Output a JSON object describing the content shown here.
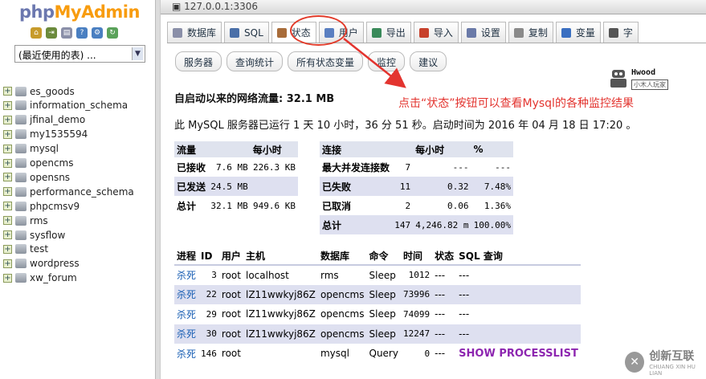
{
  "sidebar": {
    "logo_part1": "php",
    "logo_part2": "MyAdmin",
    "recent_select": "(最近使用的表) ...",
    "databases": [
      "es_goods",
      "information_schema",
      "jfinal_demo",
      "my1535594",
      "mysql",
      "opencms",
      "opensns",
      "performance_schema",
      "phpcmsv9",
      "rms",
      "sysflow",
      "test",
      "wordpress",
      "xw_forum"
    ]
  },
  "topbar": {
    "server": "127.0.0.1:3306"
  },
  "tabs": [
    "数据库",
    "SQL",
    "状态",
    "用户",
    "导出",
    "导入",
    "设置",
    "复制",
    "变量",
    "字"
  ],
  "subtabs": [
    "服务器",
    "查询统计",
    "所有状态变量",
    "监控",
    "建议"
  ],
  "traffic_heading": "自启动以来的网络流量: 32.1 MB",
  "uptime_text": "此 MySQL 服务器已运行 1 天 10 小时，36 分 51 秒。启动时间为 2016 年 04 月 18 日 17:20 。",
  "annotation": "点击“状态”按钮可以查看Mysql的各种监控结果",
  "brand": {
    "name": "Hwood",
    "tag": "小木人玩家"
  },
  "traffic": {
    "headers": [
      "流量",
      "",
      "每小时"
    ],
    "rows": [
      [
        "已接收",
        "7.6 MB",
        "226.3 KB"
      ],
      [
        "已发送",
        "24.5 MB",
        ""
      ],
      [
        "总计",
        "32.1 MB",
        "949.6 KB"
      ]
    ]
  },
  "connections": {
    "headers": [
      "连接",
      "",
      "每小时",
      "%"
    ],
    "rows": [
      [
        "最大并发连接数",
        "7",
        "---",
        "---"
      ],
      [
        "已失败",
        "11",
        "0.32",
        "7.48%"
      ],
      [
        "已取消",
        "2",
        "0.06",
        "1.36%"
      ],
      [
        "总计",
        "147",
        "4,246.82 m",
        "100.00%"
      ]
    ]
  },
  "processes": {
    "headers": [
      "进程",
      "ID",
      "用户",
      "主机",
      "数据库",
      "命令",
      "时间",
      "状态",
      "SQL 查询"
    ],
    "rows": [
      [
        "杀死",
        "3",
        "root",
        "localhost",
        "rms",
        "Sleep",
        "1012",
        "---",
        "---"
      ],
      [
        "杀死",
        "22",
        "root",
        "lZ11wwkyj86Z",
        "opencms",
        "Sleep",
        "73996",
        "---",
        "---"
      ],
      [
        "杀死",
        "29",
        "root",
        "lZ11wwkyj86Z",
        "opencms",
        "Sleep",
        "74099",
        "---",
        "---"
      ],
      [
        "杀死",
        "30",
        "root",
        "lZ11wwkyj86Z",
        "opencms",
        "Sleep",
        "12247",
        "---",
        "---"
      ],
      [
        "杀死",
        "146",
        "root",
        "",
        "mysql",
        "Query",
        "0",
        "---",
        "SHOW PROCESSLIST"
      ]
    ]
  },
  "watermark": {
    "name": "创新互联",
    "sub": "CHUANG XIN HU LIAN"
  },
  "colors": {
    "annotation": "#e3342f",
    "circle": "#e23b2a",
    "kill_link": "#1a5fb4",
    "show_query": "#8d26b0"
  }
}
